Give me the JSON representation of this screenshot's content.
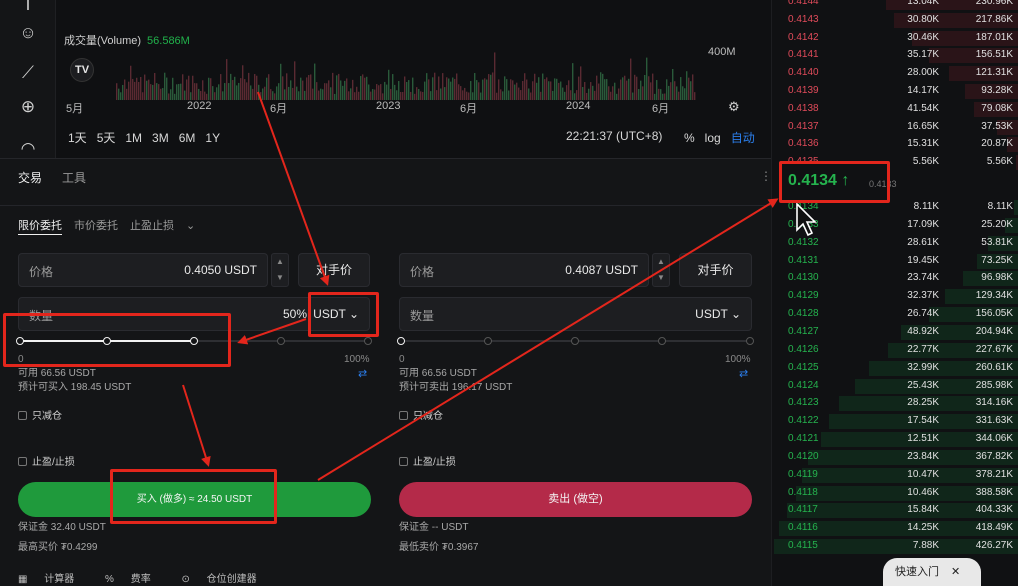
{
  "toolbar_icons": [
    "cursor-icon",
    "smiley-icon",
    "ruler-icon",
    "zoom-in-icon",
    "magnet-icon"
  ],
  "chart": {
    "volume_label": "成交量(Volume)",
    "volume_value": "56.586M",
    "axis_label": "400M",
    "logo": "TV",
    "months": [
      "5月",
      "2022",
      "6月",
      "2023",
      "6月",
      "2024",
      "6月"
    ],
    "ranges": [
      "1天",
      "5天",
      "1M",
      "3M",
      "6M",
      "1Y"
    ],
    "clock": "22:21:37 (UTC+8)",
    "scale_options": [
      "%",
      "log"
    ],
    "auto_label": "自动"
  },
  "trade": {
    "tabs": [
      "交易",
      "工具"
    ],
    "order_types": [
      "限价委托",
      "市价委托",
      "止盈止损"
    ],
    "buy": {
      "price_label": "价格",
      "price_value": "0.4050  USDT",
      "counter_label": "对手价",
      "qty_label": "数量",
      "qty_pct": "50%",
      "unit": "USDT",
      "slider_fill": 0.5,
      "slider_min": "0",
      "slider_max": "100%",
      "available": "可用 66.56 USDT",
      "estimate": "预计可买入 198.45 USDT",
      "reduce_only": "只减仓",
      "tpsl": "止盈/止损",
      "button": "买入 (做多) ≈ 24.50 USDT",
      "margin": "保证金 32.40 USDT",
      "best": "最高买价 ₮0.4299"
    },
    "sell": {
      "price_label": "价格",
      "price_value": "0.4087  USDT",
      "counter_label": "对手价",
      "qty_label": "数量",
      "unit": "USDT",
      "slider_fill": 0,
      "slider_min": "0",
      "slider_max": "100%",
      "available": "可用 66.56 USDT",
      "estimate": "预计可卖出 196.17 USDT",
      "reduce_only": "只减仓",
      "tpsl": "止盈/止损",
      "button": "卖出 (做空)",
      "margin": "保证金 -- USDT",
      "best": "最低卖价 ₮0.3967"
    },
    "footer": [
      "计算器",
      "费率",
      "仓位创建器"
    ]
  },
  "orderbook": {
    "asks": [
      {
        "price": "0.4144",
        "amount": "13.04K",
        "total": "230.96K"
      },
      {
        "price": "0.4143",
        "amount": "30.80K",
        "total": "217.86K"
      },
      {
        "price": "0.4142",
        "amount": "30.46K",
        "total": "187.01K"
      },
      {
        "price": "0.4141",
        "amount": "35.17K",
        "total": "156.51K"
      },
      {
        "price": "0.4140",
        "amount": "28.00K",
        "total": "121.31K"
      },
      {
        "price": "0.4139",
        "amount": "14.17K",
        "total": "93.28K"
      },
      {
        "price": "0.4138",
        "amount": "41.54K",
        "total": "79.08K"
      },
      {
        "price": "0.4137",
        "amount": "16.65K",
        "total": "37.53K"
      },
      {
        "price": "0.4136",
        "amount": "15.31K",
        "total": "20.87K"
      },
      {
        "price": "0.4135",
        "amount": "5.56K",
        "total": "5.56K"
      }
    ],
    "last_price": "0.4134 ↑",
    "mark_price": "0.4133",
    "bids": [
      {
        "price": "0.4134",
        "amount": "8.11K",
        "total": "8.11K"
      },
      {
        "price": "0.4133",
        "amount": "17.09K",
        "total": "25.20K"
      },
      {
        "price": "0.4132",
        "amount": "28.61K",
        "total": "53.81K"
      },
      {
        "price": "0.4131",
        "amount": "19.45K",
        "total": "73.25K"
      },
      {
        "price": "0.4130",
        "amount": "23.74K",
        "total": "96.98K"
      },
      {
        "price": "0.4129",
        "amount": "32.37K",
        "total": "129.34K"
      },
      {
        "price": "0.4128",
        "amount": "26.74K",
        "total": "156.05K"
      },
      {
        "price": "0.4127",
        "amount": "48.92K",
        "total": "204.94K"
      },
      {
        "price": "0.4126",
        "amount": "22.77K",
        "total": "227.67K"
      },
      {
        "price": "0.4125",
        "amount": "32.99K",
        "total": "260.61K"
      },
      {
        "price": "0.4124",
        "amount": "25.43K",
        "total": "285.98K"
      },
      {
        "price": "0.4123",
        "amount": "28.25K",
        "total": "314.16K"
      },
      {
        "price": "0.4122",
        "amount": "17.54K",
        "total": "331.63K"
      },
      {
        "price": "0.4121",
        "amount": "12.51K",
        "total": "344.06K"
      },
      {
        "price": "0.4120",
        "amount": "23.84K",
        "total": "367.82K"
      },
      {
        "price": "0.4119",
        "amount": "10.47K",
        "total": "378.21K"
      },
      {
        "price": "0.4118",
        "amount": "10.46K",
        "total": "388.58K"
      },
      {
        "price": "0.4117",
        "amount": "15.84K",
        "total": "404.33K"
      },
      {
        "price": "0.4116",
        "amount": "14.25K",
        "total": "418.49K"
      },
      {
        "price": "0.4115",
        "amount": "7.88K",
        "total": "426.27K"
      }
    ],
    "quick_entry": "快速入门",
    "close": "✕"
  },
  "colors": {
    "buy": "#1f9a3c",
    "sell": "#b42a49",
    "up": "#25b34e",
    "down": "#e04b5a",
    "annotation": "#e3261c",
    "link": "#2b7de9"
  }
}
